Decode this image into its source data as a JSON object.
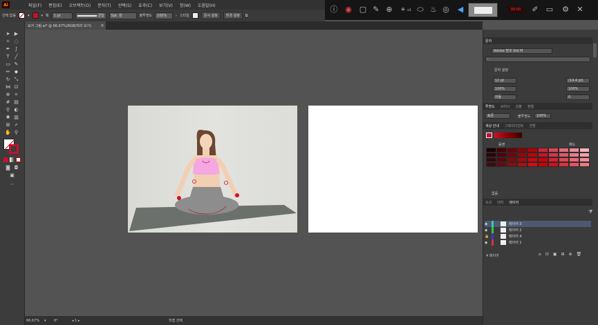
{
  "app": {
    "logo": "Ai"
  },
  "menu": [
    "파일(F)",
    "편집(E)",
    "오브젝트(O)",
    "문자(T)",
    "선택(S)",
    "효과(C)",
    "보기(V)",
    "창(W)",
    "도움말(H)"
  ],
  "control_bar": {
    "selection_label": "선택 없음",
    "stroke_label": "획",
    "stroke_value": "1 pt",
    "brush_value": "균일",
    "style_value": "5pt. 원",
    "opacity_label": "불투명도",
    "opacity_value": "100%",
    "style_label": "스타일",
    "doc_setup_button": "문서 설정",
    "prefs_button": "환경 설정"
  },
  "recorder": {
    "zoom_label": "x1"
  },
  "document_tab": {
    "title": "요가 그림.ai* @ 66.67%(RGB/미리 보기)",
    "close": "×"
  },
  "panels": {
    "character": {
      "tab": "문자",
      "font_family": "Adobe 명조 Std M",
      "font_style": "-",
      "font_size": "12 pt",
      "leading": "(14.4 pt)",
      "vscale": "100%",
      "hscale": "100%",
      "kerning": "자동",
      "tracking": "0",
      "shift": "0",
      "font_label": "문자 설정"
    },
    "transparency": {
      "tabs": [
        "투명도",
        "브러시",
        "심볼",
        "정렬"
      ],
      "blend_mode": "표준",
      "opacity_label": "불투명도",
      "opacity_value": "100%"
    },
    "swatches": {
      "tabs": [
        "색상 안내",
        "그레이디언트",
        "견본"
      ],
      "left_label": "음영",
      "right_label": "채도",
      "bottom_label": "없음"
    },
    "layers": {
      "tabs": [
        "속성",
        "대지",
        "레이어"
      ],
      "items": [
        {
          "name": "레이어 3"
        },
        {
          "name": "레이어 2"
        },
        {
          "name": "레이어 4"
        },
        {
          "name": "레이어 1"
        }
      ],
      "footer": "4 레이어"
    }
  },
  "status_bar": {
    "zoom": "66.67%",
    "rotation": "0°",
    "artboard": "1",
    "tool": "직접 선택"
  },
  "colors": {
    "accent_red": "#c8102e",
    "mat": "#6b706c",
    "top": "#f4a7e0",
    "leggings": "#8d8d8d",
    "hair": "#6b4632"
  }
}
